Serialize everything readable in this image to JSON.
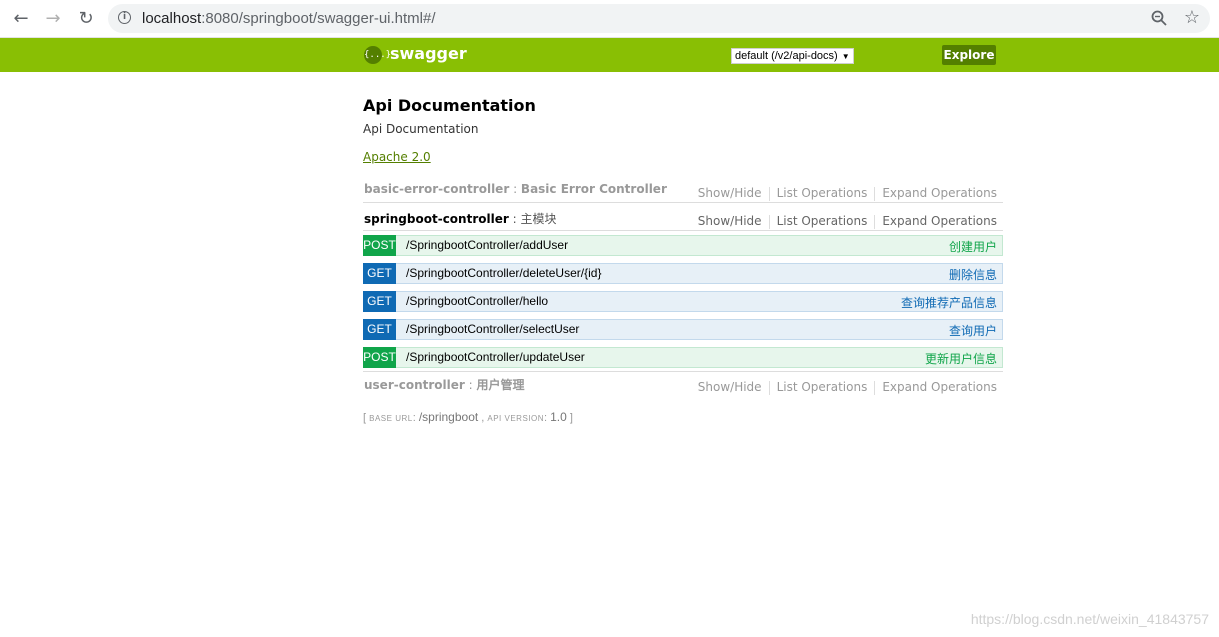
{
  "browser": {
    "url_host": "localhost",
    "url_rest": ":8080/springboot/swagger-ui.html#/"
  },
  "header": {
    "logo_text": "swagger",
    "api_select": "default (/v2/api-docs)",
    "explore_label": "Explore",
    "brand_color": "#89bf04"
  },
  "info": {
    "title": "Api Documentation",
    "description": "Api Documentation",
    "license": "Apache 2.0"
  },
  "links": {
    "show_hide": "Show/Hide",
    "list_ops": "List Operations",
    "expand_ops": "Expand Operations"
  },
  "resources": [
    {
      "name": "basic-error-controller",
      "sep": " : ",
      "desc": "Basic Error Controller"
    },
    {
      "name": "springboot-controller",
      "sep": " : ",
      "desc": "主模块"
    },
    {
      "name": "user-controller",
      "sep": " : ",
      "desc": "用户管理"
    }
  ],
  "operations": [
    {
      "method": "POST",
      "path": "/SpringbootController/addUser",
      "summary": "创建用户"
    },
    {
      "method": "GET",
      "path": "/SpringbootController/deleteUser/{id}",
      "summary": "删除信息"
    },
    {
      "method": "GET",
      "path": "/SpringbootController/hello",
      "summary": "查询推荐产品信息"
    },
    {
      "method": "GET",
      "path": "/SpringbootController/selectUser",
      "summary": "查询用户"
    },
    {
      "method": "POST",
      "path": "/SpringbootController/updateUser",
      "summary": "更新用户信息"
    }
  ],
  "footer": {
    "open": "[ ",
    "base_url_label": "BASE URL",
    "base_url": "/springboot",
    "api_version_label": "API VERSION",
    "api_version": "1.0",
    "close": " ]"
  },
  "watermark": "https://blog.csdn.net/weixin_41843757"
}
